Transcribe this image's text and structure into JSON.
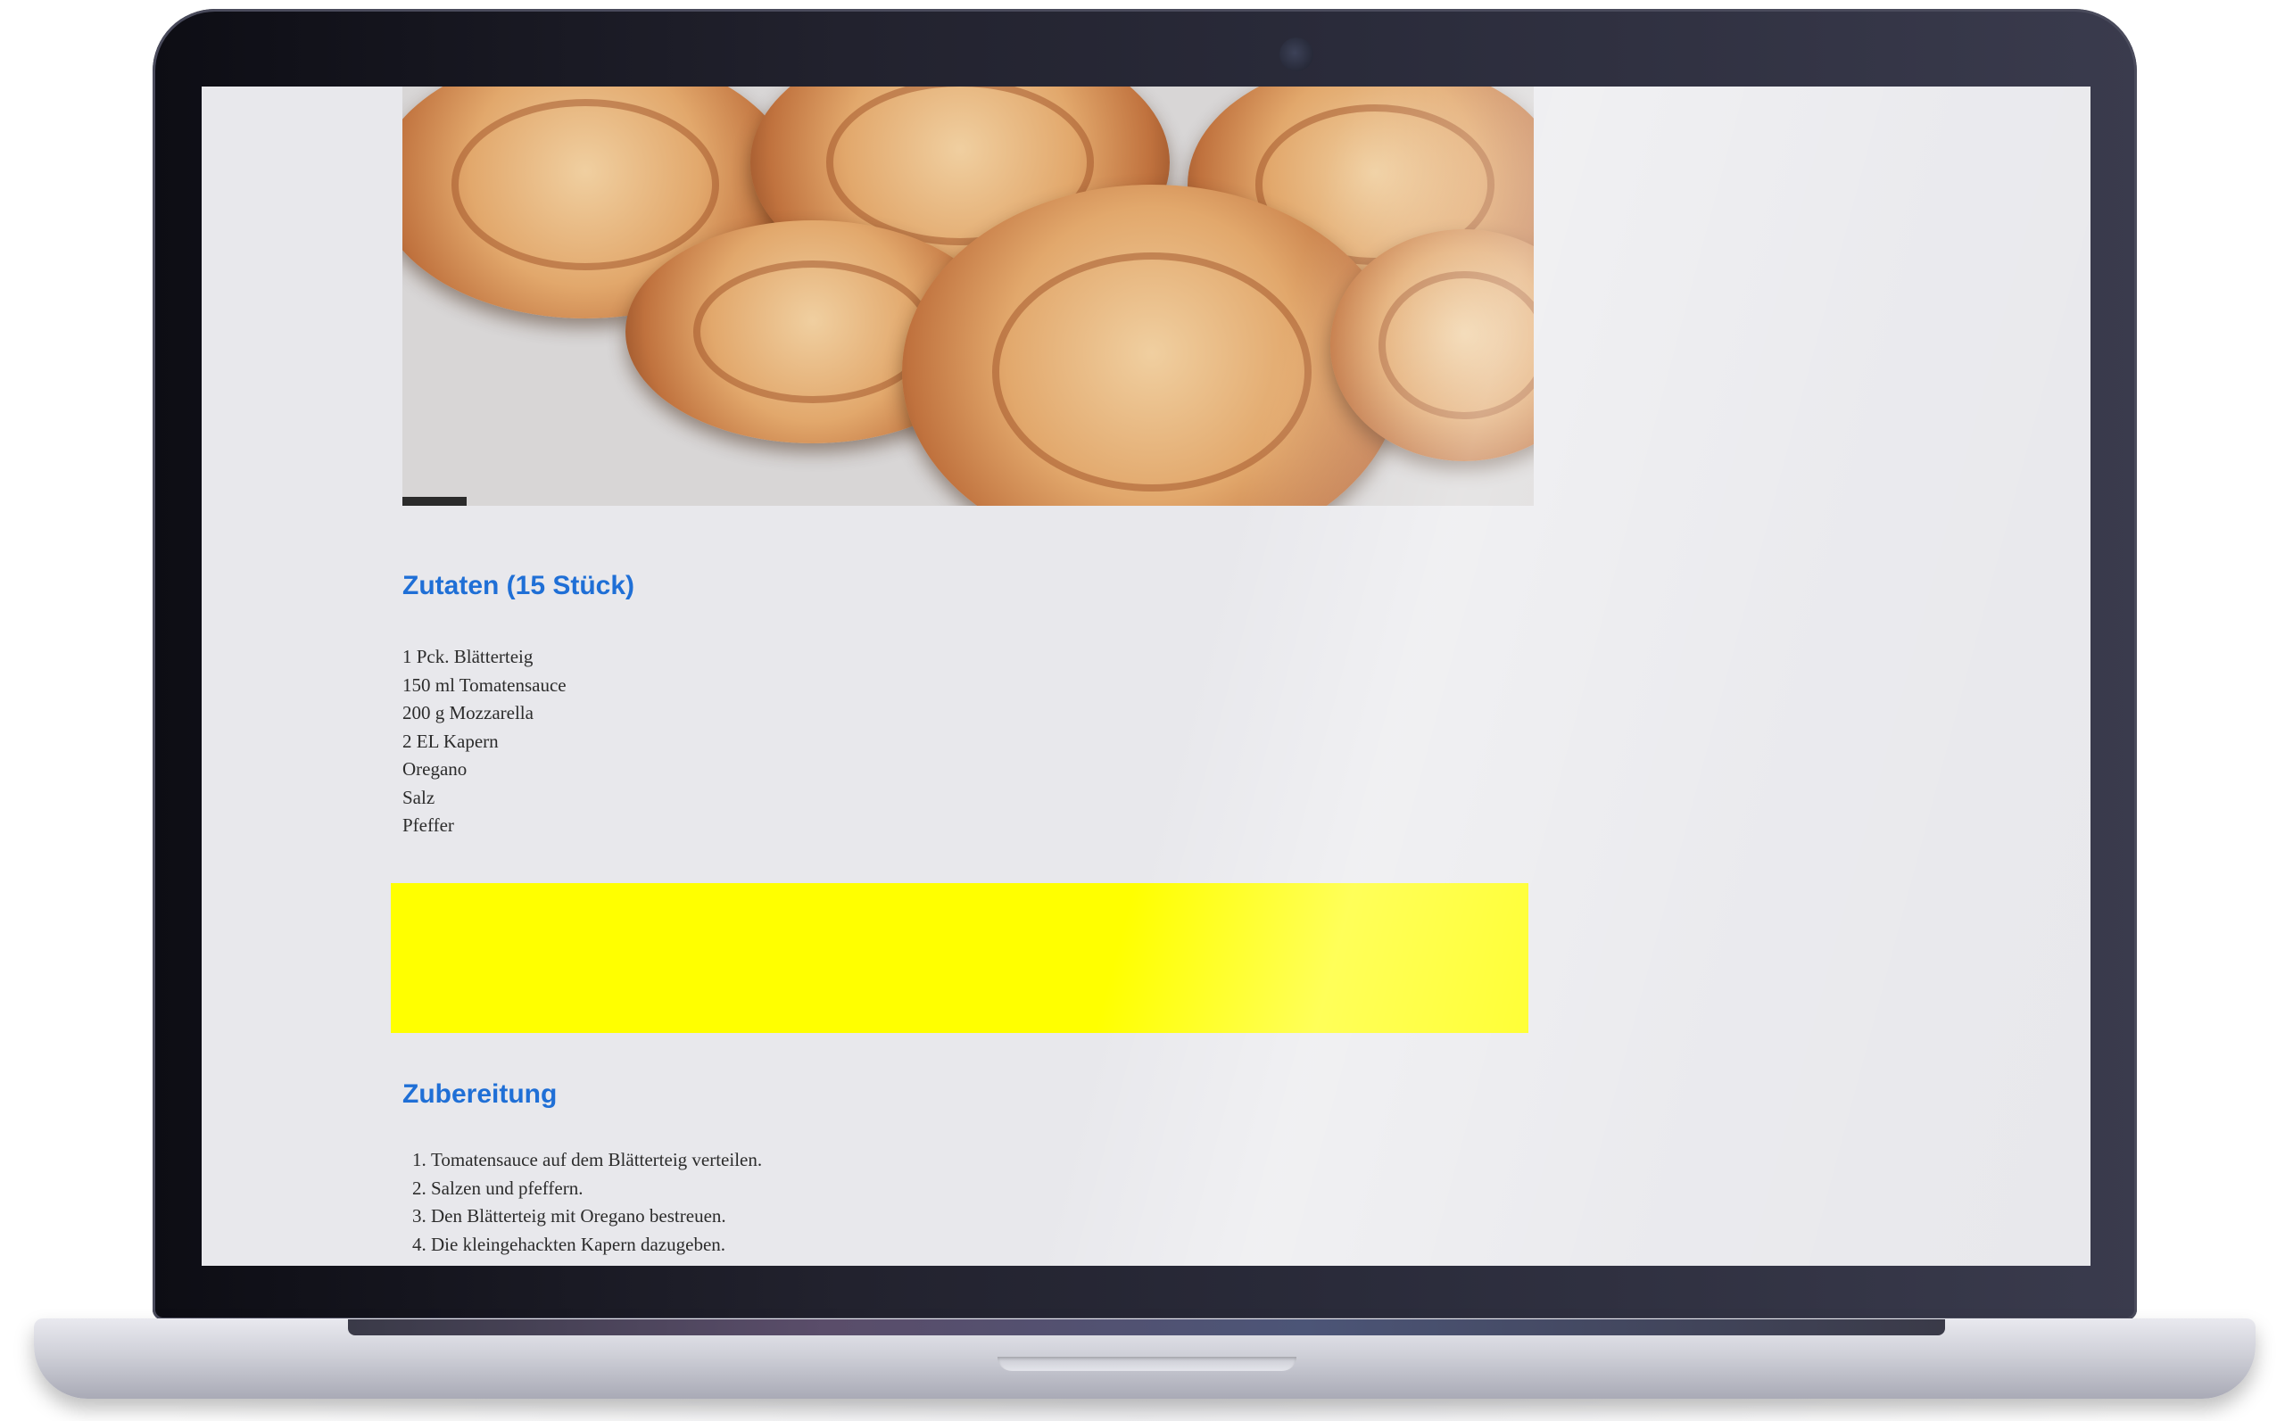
{
  "recipe": {
    "hero_image_alt": "food-photo",
    "ingredients_title": "Zutaten (15 Stück)",
    "ingredients": [
      "1 Pck. Blätterteig",
      "150 ml Tomatensauce",
      "200 g Mozzarella",
      "2 EL Kapern",
      "Oregano",
      "Salz",
      "Pfeffer"
    ],
    "ad_banner_color": "#ffff00",
    "steps_title": "Zubereitung",
    "steps": [
      "Tomatensauce auf dem Blätterteig verteilen.",
      "Salzen und pfeffern.",
      "Den Blätterteig mit Oregano bestreuen.",
      "Die kleingehackten Kapern dazugeben."
    ]
  },
  "colors": {
    "heading": "#1f6fd6",
    "body_text": "#2c2c2c",
    "page_background": "#e8e8ec"
  }
}
